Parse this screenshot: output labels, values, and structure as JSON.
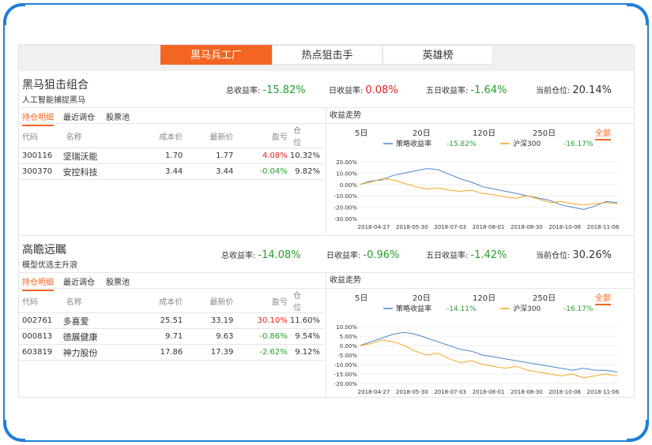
{
  "tabs": [
    {
      "label": "黑马兵工厂",
      "active": true
    },
    {
      "label": "热点狙击手",
      "active": false
    },
    {
      "label": "英雄榜",
      "active": false
    }
  ],
  "stat_labels": {
    "total": "总收益率:",
    "day": "日收益率:",
    "five": "五日收益率:",
    "position": "当前仓位:"
  },
  "subtabs": [
    "持仓明细",
    "最近调仓",
    "股票池"
  ],
  "columns": [
    "代码",
    "名称",
    "成本价",
    "最新价",
    "盈亏",
    "仓位"
  ],
  "chart_title": "收益走势",
  "ranges": [
    "5日",
    "20日",
    "120日",
    "250日",
    "全部"
  ],
  "colors": {
    "strategy": "#4a86c8",
    "index": "#f5a623",
    "accent": "#f26522"
  },
  "portfolios": [
    {
      "name": "黑马狙击组合",
      "subtitle": "人工智能捕捉黑马",
      "total": "-15.82%",
      "day": "0.08%",
      "five": "-1.64%",
      "position": "20.14%",
      "rows": [
        {
          "code": "300116",
          "name": "坚瑞沃能",
          "cost": "1.70",
          "last": "1.77",
          "pl": "4.08%",
          "weight": "10.32%"
        },
        {
          "code": "300370",
          "name": "安控科技",
          "cost": "3.44",
          "last": "3.44",
          "pl": "-0.04%",
          "weight": "9.82%"
        }
      ],
      "legend": [
        {
          "name": "策略收益率",
          "value": "-15.82%"
        },
        {
          "name": "沪深300",
          "value": "-16.17%"
        }
      ],
      "chart_data": {
        "type": "line",
        "x": [
          "2018-04-27",
          "2018-05-30",
          "2018-07-03",
          "2018-08-01",
          "2018-08-30",
          "2018-10-08",
          "2018-11-06"
        ],
        "yticks": [
          "20.00%",
          "10.00%",
          "0.00%",
          "-10.00%",
          "-20.00%",
          "-30.00%"
        ],
        "ylim": [
          -30,
          20
        ],
        "series": [
          {
            "name": "策略收益率",
            "values": [
              0,
              3,
              4,
              8,
              10,
              12,
              14,
              13,
              9,
              5,
              2,
              -2,
              -4,
              -6,
              -8,
              -10,
              -12,
              -14,
              -18,
              -20,
              -22,
              -19,
              -15,
              -16
            ]
          },
          {
            "name": "沪深300",
            "values": [
              0,
              2,
              5,
              4,
              1,
              -2,
              -4,
              -3,
              -5,
              -6,
              -5,
              -8,
              -9,
              -11,
              -12,
              -10,
              -13,
              -16,
              -15,
              -17,
              -18,
              -17,
              -16,
              -17
            ]
          }
        ]
      }
    },
    {
      "name": "高瞻远瞩",
      "subtitle": "模型优选主升浪",
      "total": "-14.08%",
      "day": "-0.96%",
      "five": "-1.42%",
      "position": "30.26%",
      "rows": [
        {
          "code": "002761",
          "name": "多喜爱",
          "cost": "25.51",
          "last": "33.19",
          "pl": "30.10%",
          "weight": "11.60%"
        },
        {
          "code": "000813",
          "name": "德展健康",
          "cost": "9.71",
          "last": "9.63",
          "pl": "-0.86%",
          "weight": "9.54%"
        },
        {
          "code": "603819",
          "name": "神力股份",
          "cost": "17.86",
          "last": "17.39",
          "pl": "-2.62%",
          "weight": "9.12%"
        }
      ],
      "legend": [
        {
          "name": "策略收益率",
          "value": "-14.11%"
        },
        {
          "name": "沪深300",
          "value": "-16.17%"
        }
      ],
      "chart_data": {
        "type": "line",
        "x": [
          "2018-04-27",
          "2018-05-30",
          "2018-07-03",
          "2018-08-01",
          "2018-08-30",
          "2018-10-08",
          "2018-11-06"
        ],
        "yticks": [
          "10.00%",
          "5.00%",
          "0.00%",
          "-5.00%",
          "-10.00%",
          "-15.00%",
          "-20.00%"
        ],
        "ylim": [
          -20,
          10
        ],
        "series": [
          {
            "name": "策略收益率",
            "values": [
              0,
              2,
              4,
              6,
              7,
              6,
              4,
              2,
              0,
              -2,
              -3,
              -5,
              -6,
              -7,
              -8,
              -9,
              -10,
              -11,
              -12,
              -13,
              -12,
              -13,
              -13,
              -14
            ]
          },
          {
            "name": "沪深300",
            "values": [
              0,
              1,
              3,
              2,
              0,
              -3,
              -5,
              -4,
              -7,
              -9,
              -8,
              -10,
              -11,
              -12,
              -11,
              -13,
              -14,
              -15,
              -16,
              -15,
              -17,
              -16,
              -15,
              -16
            ]
          }
        ]
      }
    }
  ]
}
